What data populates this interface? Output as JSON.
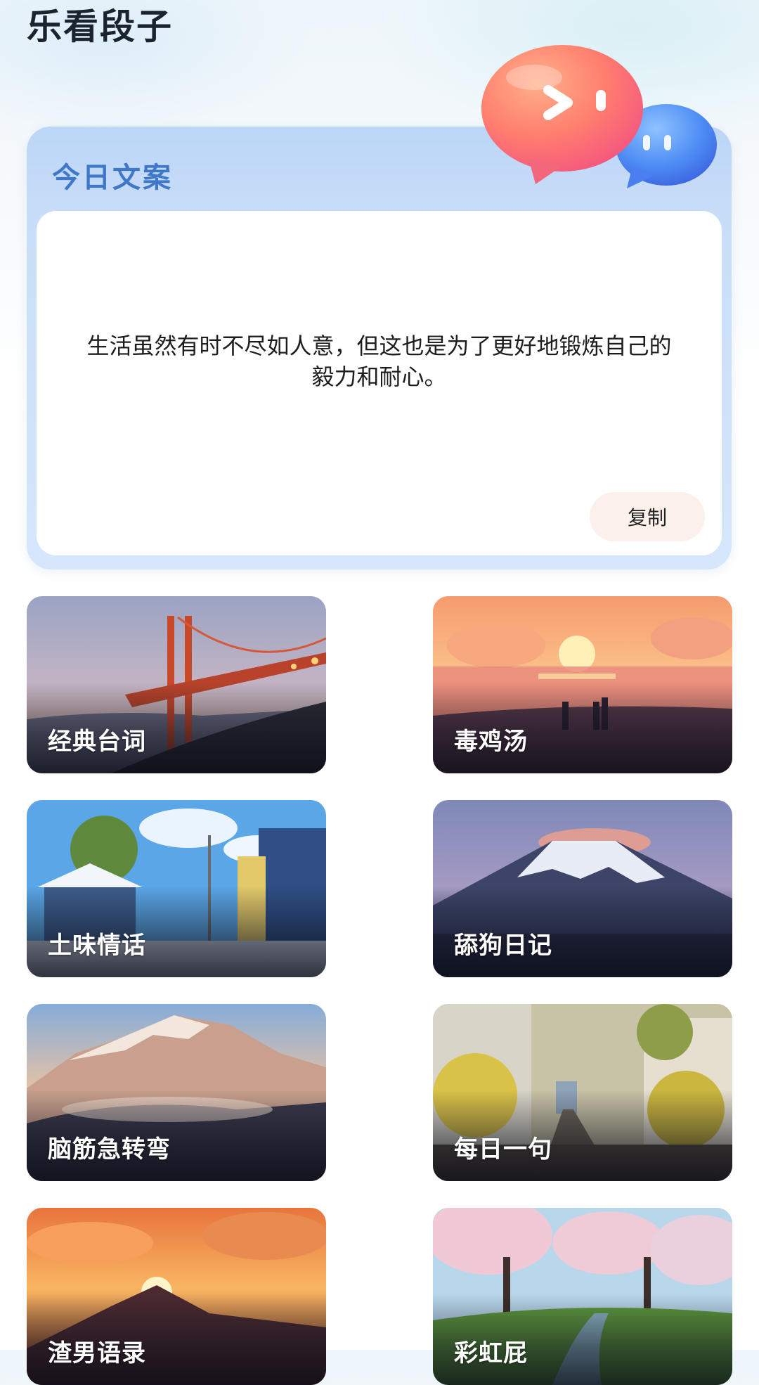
{
  "app": {
    "title": "乐看段子"
  },
  "daily": {
    "title": "今日文案",
    "quote": "生活虽然有时不尽如人意，但这也是为了更好地锻炼自己的毅力和耐心。",
    "copy_label": "复制"
  },
  "categories": [
    {
      "label": "经典台词",
      "scene": "golden-gate-bridge-at-dusk"
    },
    {
      "label": "毒鸡汤",
      "scene": "sunset-beach-silhouettes"
    },
    {
      "label": "土味情话",
      "scene": "snowy-village-street-blue-sky"
    },
    {
      "label": "舔狗日记",
      "scene": "snow-capped-volcano-purple-sky"
    },
    {
      "label": "脑筋急转弯",
      "scene": "snowy-mountain-range-sunrise"
    },
    {
      "label": "每日一句",
      "scene": "railway-street-yellow-flowers"
    },
    {
      "label": "渣男语录",
      "scene": "mountain-sunset-clouds"
    },
    {
      "label": "彩虹屁",
      "scene": "cherry-blossom-valley"
    }
  ]
}
